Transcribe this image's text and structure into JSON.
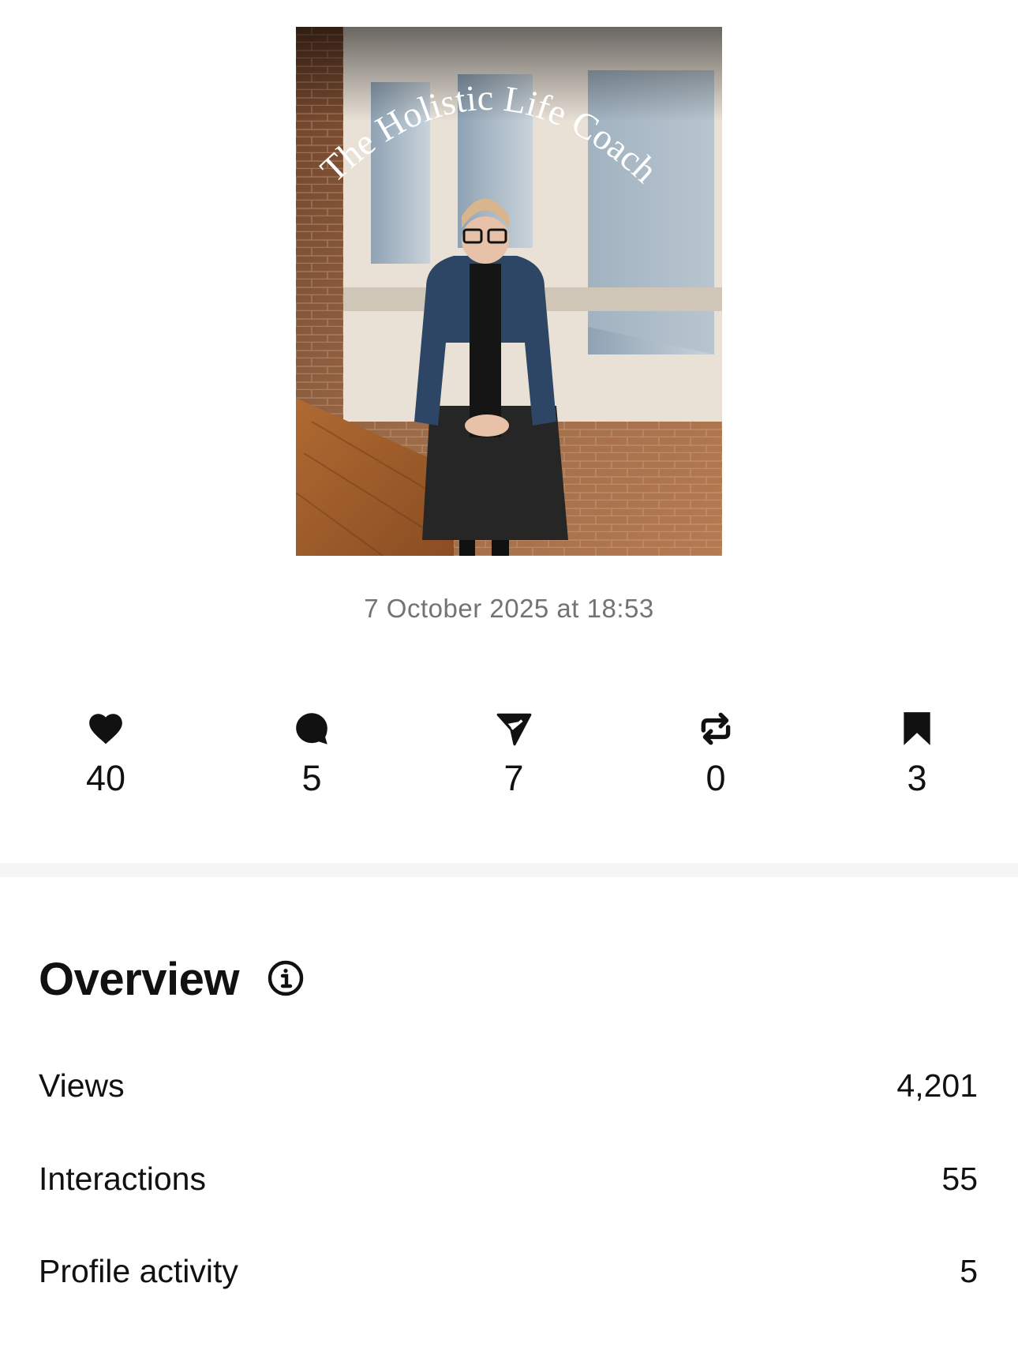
{
  "post": {
    "image_alt": "The Holistic Life Coach",
    "image_caption_text": "The Holistic Life Coach",
    "timestamp": "7 October 2025 at 18:53"
  },
  "metrics": [
    {
      "name": "likes",
      "icon": "heart-icon",
      "count": "40"
    },
    {
      "name": "comments",
      "icon": "comment-icon",
      "count": "5"
    },
    {
      "name": "shares",
      "icon": "send-icon",
      "count": "7"
    },
    {
      "name": "reposts",
      "icon": "repost-icon",
      "count": "0"
    },
    {
      "name": "saves",
      "icon": "bookmark-icon",
      "count": "3"
    }
  ],
  "overview": {
    "title": "Overview",
    "info_icon": "info-icon",
    "rows": [
      {
        "label": "Views",
        "value": "4,201"
      },
      {
        "label": "Interactions",
        "value": "55"
      },
      {
        "label": "Profile activity",
        "value": "5"
      }
    ]
  },
  "colors": {
    "text": "#111111",
    "muted": "#737373",
    "divider": "#f5f5f5",
    "background": "#ffffff"
  }
}
